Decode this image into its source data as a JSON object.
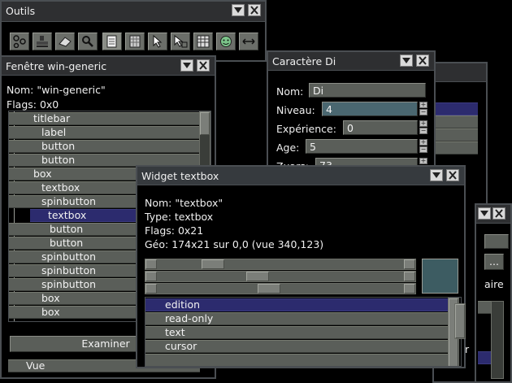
{
  "tools_window": {
    "title": "Outils",
    "icons": [
      "nodes-icon",
      "stamp-icon",
      "eraser-icon",
      "magnifier-icon",
      "page-icon",
      "grid-page-icon",
      "pointer-icon",
      "pointer-select-icon",
      "table-icon",
      "face-icon",
      "resize-horizontal-icon"
    ]
  },
  "win_generic": {
    "title": "Fenêtre win-generic",
    "name_line": "Nom: \"win-generic\"",
    "flags_line": "Flags: 0x0",
    "tree": [
      "titlebar",
      "label",
      "button",
      "button",
      "box",
      "textbox",
      "spinbutton",
      "textbox",
      "button",
      "button",
      "spinbutton",
      "spinbutton",
      "spinbutton",
      "box",
      "box"
    ],
    "selected_index": 7,
    "examine_button": "Examiner",
    "bottom_label": "Vue"
  },
  "char_window": {
    "title": "Caractère Di",
    "fields": [
      {
        "label": "Nom:",
        "value": "Di"
      },
      {
        "label": "Niveau:",
        "value": "4"
      },
      {
        "label": "Expérience:",
        "value": "0"
      },
      {
        "label": "Age:",
        "value": "5"
      },
      {
        "label": "Zuars:",
        "value": "73"
      }
    ]
  },
  "back_window": {
    "ellipsis_button": "...",
    "partial_label": "aire",
    "partial_text": "r"
  },
  "textbox_window": {
    "title": "Widget textbox",
    "name_line": "Nom: \"textbox\"",
    "type_line": "Type: textbox",
    "flags_line": "Flags: 0x21",
    "geo_line": "Géo: 174x21 sur 0,0 (vue 340,123)",
    "sliders": [
      0.2,
      0.4,
      0.45
    ],
    "color_swatch": "#3d5c62",
    "flag_list": [
      "edition",
      "read-only",
      "text",
      "cursor"
    ],
    "flag_selected_index": 0
  },
  "colors": {
    "selection": "#2c2b6e",
    "active_field": "#4a6770"
  }
}
